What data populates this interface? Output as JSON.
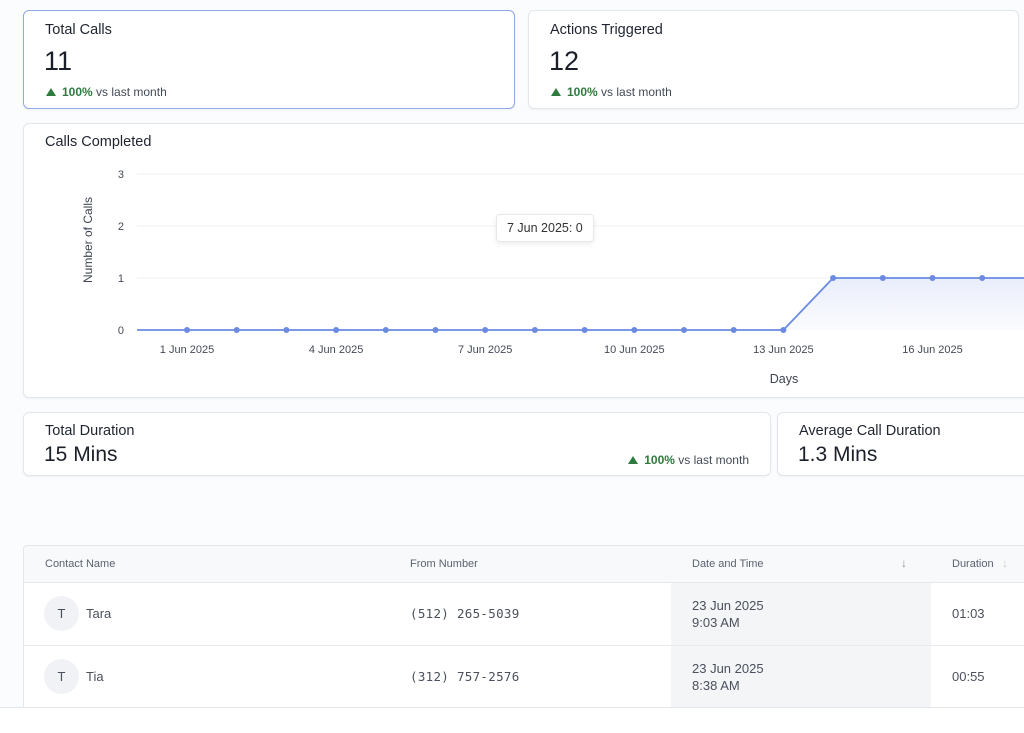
{
  "stats": {
    "total_calls": {
      "title": "Total Calls",
      "value": "11",
      "trend_pct": "100%",
      "trend_text": "vs last month"
    },
    "actions_triggered": {
      "title": "Actions Triggered",
      "value": "12",
      "trend_pct": "100%",
      "trend_text": "vs last month"
    },
    "total_duration": {
      "title": "Total Duration",
      "value": "15 Mins",
      "trend_pct": "100%",
      "trend_text": "vs last month"
    },
    "avg_call_duration": {
      "title": "Average Call Duration",
      "value": "1.3 Mins"
    }
  },
  "chart": {
    "title": "Calls Completed",
    "tooltip": "7 Jun 2025: 0"
  },
  "chart_data": {
    "type": "area",
    "title": "Calls Completed",
    "xlabel": "Days",
    "ylabel": "Number of Calls",
    "ylim": [
      0,
      3
    ],
    "yticks": [
      0,
      1,
      2,
      3
    ],
    "x": [
      "1 Jun 2025",
      "2 Jun 2025",
      "3 Jun 2025",
      "4 Jun 2025",
      "5 Jun 2025",
      "6 Jun 2025",
      "7 Jun 2025",
      "8 Jun 2025",
      "9 Jun 2025",
      "10 Jun 2025",
      "11 Jun 2025",
      "12 Jun 2025",
      "13 Jun 2025",
      "14 Jun 2025",
      "15 Jun 2025",
      "16 Jun 2025",
      "17 Jun 2025",
      "18 Jun 2025"
    ],
    "xtick_labels": [
      "1 Jun 2025",
      "4 Jun 2025",
      "7 Jun 2025",
      "10 Jun 2025",
      "13 Jun 2025",
      "16 Jun 2025"
    ],
    "series": [
      {
        "values": [
          0,
          0,
          0,
          0,
          0,
          0,
          0,
          0,
          0,
          0,
          0,
          0,
          0,
          1,
          1,
          1,
          1,
          1
        ]
      }
    ],
    "grid": true,
    "line_color": "#6b8be3",
    "fill_color": "#eef1fb"
  },
  "table": {
    "columns": [
      {
        "label": "Contact Name"
      },
      {
        "label": "From Number"
      },
      {
        "label": "Date and Time"
      },
      {
        "label": "Duration"
      }
    ],
    "rows": [
      {
        "initial": "T",
        "name": "Tara",
        "number": "(512) 265-5039",
        "date": "23 Jun 2025",
        "time": "9:03 AM",
        "duration": "01:03"
      },
      {
        "initial": "T",
        "name": "Tia",
        "number": "(312) 757-2576",
        "date": "23 Jun 2025",
        "time": "8:38 AM",
        "duration": "00:55"
      }
    ]
  },
  "icons": {
    "trend_up": "triangle-up-icon",
    "sort": "arrow-down-icon"
  },
  "colors": {
    "accent": "#6b8be3",
    "positive": "#2f7a3e",
    "active_border": "#8fa8e6"
  }
}
